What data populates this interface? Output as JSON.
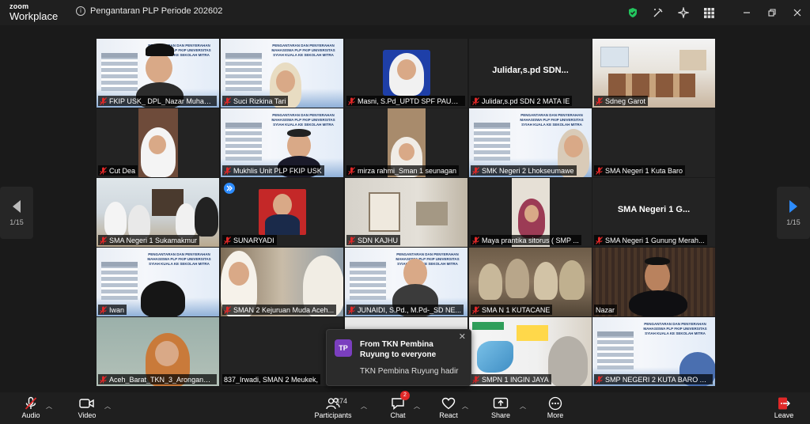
{
  "app": {
    "logo_line1": "zoom",
    "logo_line2": "Workplace"
  },
  "meeting": {
    "title": "Pengantaran PLP Periode 202602"
  },
  "pager": {
    "left": "1/15",
    "right": "1/15"
  },
  "tiles": [
    {
      "name": "FKIP USK_ DPL_Nazar Muham..."
    },
    {
      "name": "Suci Rizkina Tari"
    },
    {
      "name": "Masni, S.Pd_UPTD SPF PAUD ..."
    },
    {
      "name": "Julidar,s.pd SDN 2 MATA IE",
      "display": "Julidar,s.pd  SDN..."
    },
    {
      "name": "Sdneg Garot"
    },
    {
      "name": "Cut Dea"
    },
    {
      "name": "Mukhlis Unit PLP FKIP USK"
    },
    {
      "name": "mirza rahmi_Sman 1 seunagan"
    },
    {
      "name": "SMK Negeri 2 Lhokseumawe"
    },
    {
      "name": "SMA Negeri 1 Kuta Baro"
    },
    {
      "name": "SMA Negeri 1 Sukamakmur"
    },
    {
      "name": "SUNARYADI"
    },
    {
      "name": "SDN KAJHU"
    },
    {
      "name": "Maya prantika sitorus ( SMP ..."
    },
    {
      "name": "SMA Negeri 1 Gunung Merah...",
      "display": "SMA Negeri 1 G..."
    },
    {
      "name": "Iwan"
    },
    {
      "name": "SMAN 2 Kejuruan Muda Aceh..."
    },
    {
      "name": "JUNAIDI, S.Pd., M.Pd-_SD NE..."
    },
    {
      "name": "SMA N 1 KUTACANE"
    },
    {
      "name": "Nazar"
    },
    {
      "name": "Aceh_Barat_TKN_3_Arongan_L..."
    },
    {
      "name": "837_Irwadi, SMAN 2 Meukek,"
    },
    {
      "name": ""
    },
    {
      "name": "SMPN 1 INGIN JAYA"
    },
    {
      "name": "SMP NEGERI 2 KUTA BARO ACE..."
    }
  ],
  "banner_text": "PENGANTARAN DAN PENYERAHAN MAHASISWA PLP FKIP UNIVERSITAS SYIAH KUALA KE SEKOLAH MITRA",
  "chat_popup": {
    "avatar": "TP",
    "from": "From TKN Pembina Ruyung to everyone",
    "message": "TKN Pembina Ruyung hadir"
  },
  "toolbar": {
    "audio": "Audio",
    "video": "Video",
    "participants": "Participants",
    "participants_count": "374",
    "chat": "Chat",
    "chat_badge": "2",
    "react": "React",
    "share": "Share",
    "more": "More",
    "leave": "Leave"
  },
  "colors": {
    "active_speaker": "#23d959",
    "muted": "#e02828",
    "shield": "#23c55e"
  }
}
